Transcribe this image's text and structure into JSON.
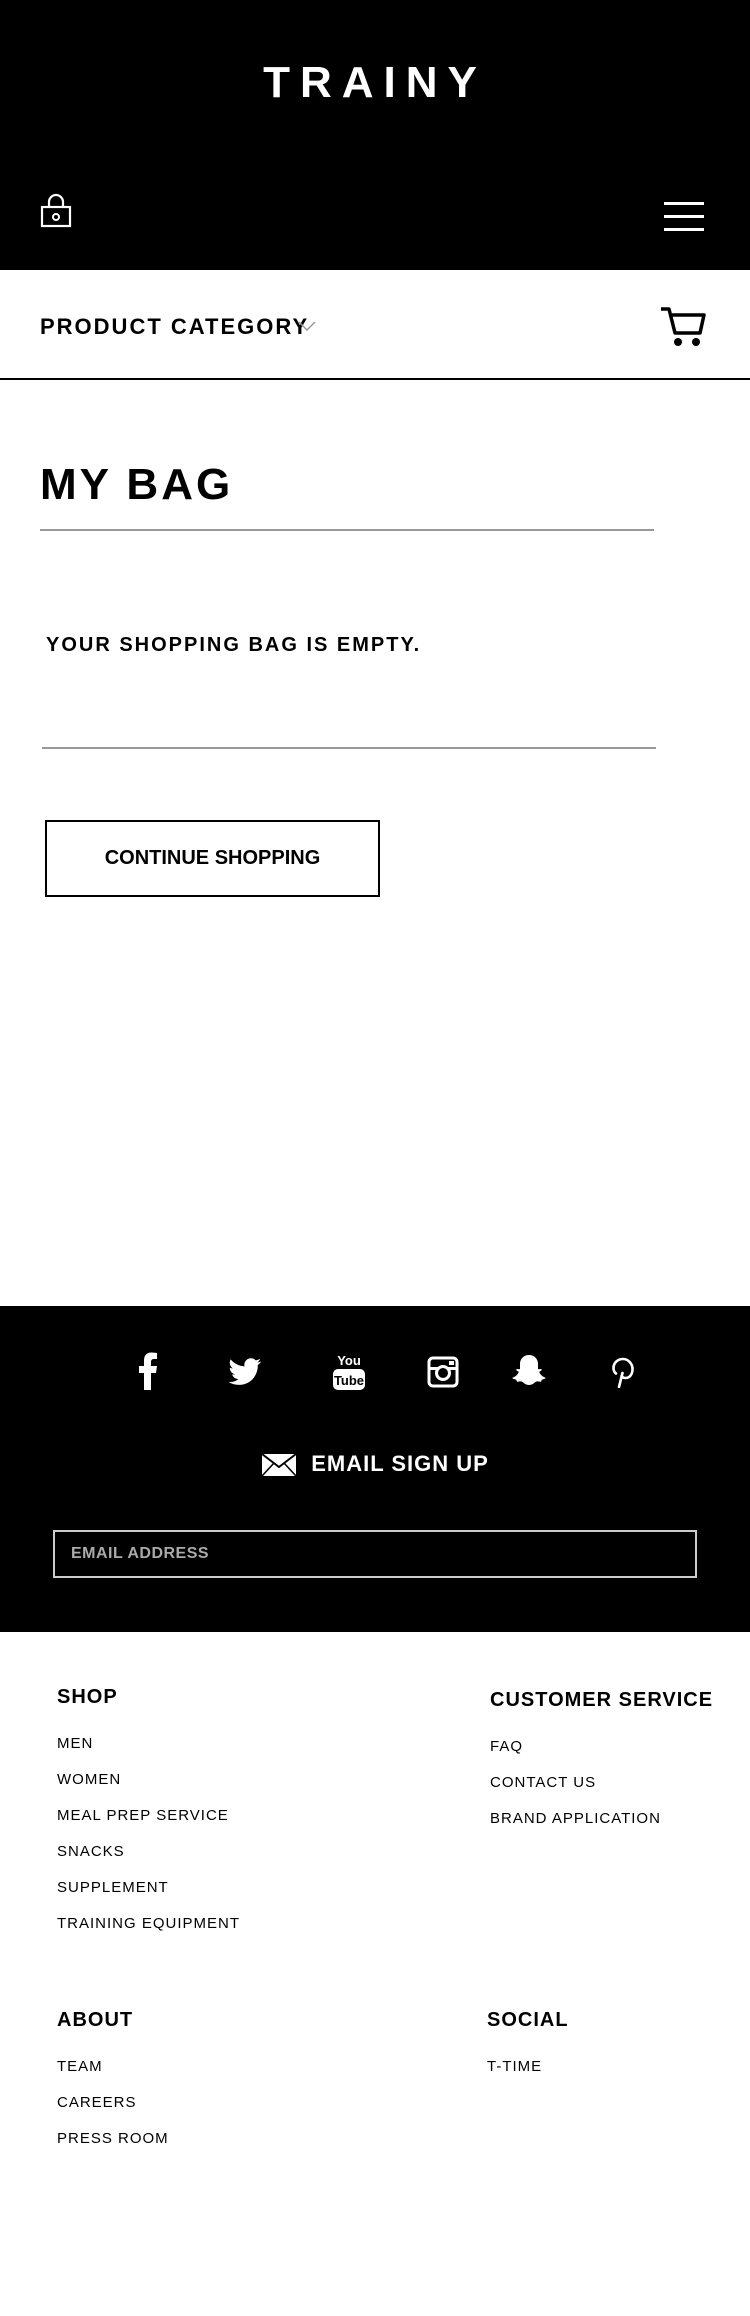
{
  "header": {
    "logo": "TRAINY"
  },
  "category_bar": {
    "label": "PRODUCT CATEGORY"
  },
  "bag": {
    "title": "MY BAG",
    "empty_message": "YOUR SHOPPING BAG IS EMPTY.",
    "continue_label": "CONTINUE SHOPPING"
  },
  "footer_band": {
    "social_icons": [
      "facebook-icon",
      "twitter-icon",
      "youtube-icon",
      "instagram-icon",
      "snapchat-icon",
      "pinterest-icon"
    ],
    "email_signup_label": "EMAIL SIGN UP",
    "email_placeholder": "EMAIL ADDRESS"
  },
  "links": {
    "shop": {
      "heading": "SHOP",
      "items": [
        "MEN",
        "WOMEN",
        "MEAL PREP SERVICE",
        "SNACKS",
        "SUPPLEMENT",
        "TRAINING EQUIPMENT"
      ]
    },
    "customer_service": {
      "heading": "CUSTOMER SERVICE",
      "items": [
        "FAQ",
        "CONTACT US",
        "BRAND APPLICATION"
      ]
    },
    "about": {
      "heading": "ABOUT",
      "items": [
        "TEAM",
        "CAREERS",
        "PRESS ROOM"
      ]
    },
    "social": {
      "heading": "SOCIAL",
      "items": [
        "T-TIME"
      ]
    }
  },
  "colors": {
    "header_bg": "#000000",
    "text": "#000000",
    "rule": "#999999"
  }
}
